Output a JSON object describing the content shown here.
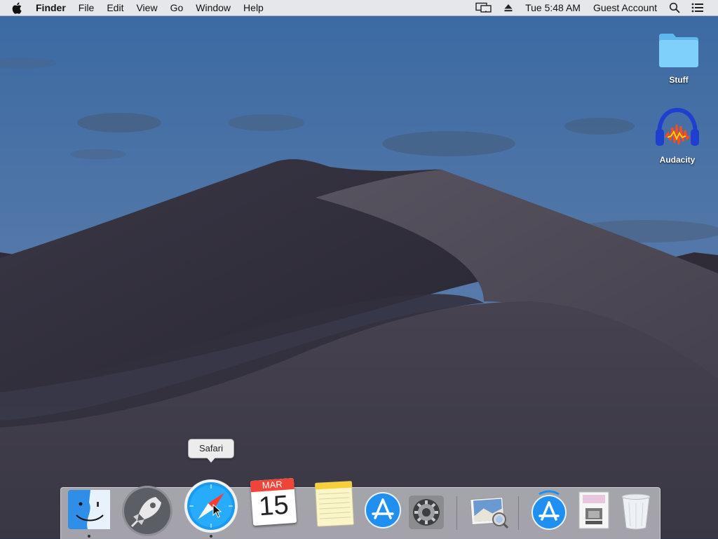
{
  "menubar": {
    "app_name": "Finder",
    "menus": [
      "File",
      "Edit",
      "View",
      "Go",
      "Window",
      "Help"
    ],
    "clock": "Tue 5:48 AM",
    "user": "Guest Account",
    "icons": [
      "apple-icon",
      "display-mirroring-icon",
      "eject-icon",
      "spotlight-search-icon",
      "notification-center-icon"
    ]
  },
  "desktop": {
    "icons": [
      {
        "label": "Stuff",
        "icon": "folder-icon"
      },
      {
        "label": "Audacity",
        "icon": "audacity-icon"
      }
    ]
  },
  "dock": {
    "tooltip": "Safari",
    "calendar_month": "MAR",
    "calendar_day": "15",
    "items": [
      {
        "name": "Finder",
        "icon": "finder-icon",
        "running": true
      },
      {
        "name": "Launchpad",
        "icon": "launchpad-icon",
        "running": false
      },
      {
        "name": "Safari",
        "icon": "safari-icon",
        "running": true
      },
      {
        "name": "Calendar",
        "icon": "calendar-icon",
        "running": false
      },
      {
        "name": "Notes",
        "icon": "notes-icon",
        "running": false
      },
      {
        "name": "App Store",
        "icon": "app-store-icon",
        "running": false
      },
      {
        "name": "System Preferences",
        "icon": "system-preferences-icon",
        "running": false
      },
      {
        "name": "Preview",
        "icon": "preview-icon",
        "running": false
      },
      {
        "name": "App Store",
        "icon": "app-store-icon",
        "running": false
      },
      {
        "name": "Document",
        "icon": "document-icon",
        "running": false
      },
      {
        "name": "Trash",
        "icon": "trash-icon",
        "running": false
      }
    ]
  },
  "colors": {
    "sky_top": "#3e6ea7",
    "sky_bottom": "#5c7fae",
    "dune_dark": "#2a2733",
    "dune_light": "#4a4656",
    "menubar_bg": "#ececee",
    "folder_blue": "#6cc5f5"
  }
}
